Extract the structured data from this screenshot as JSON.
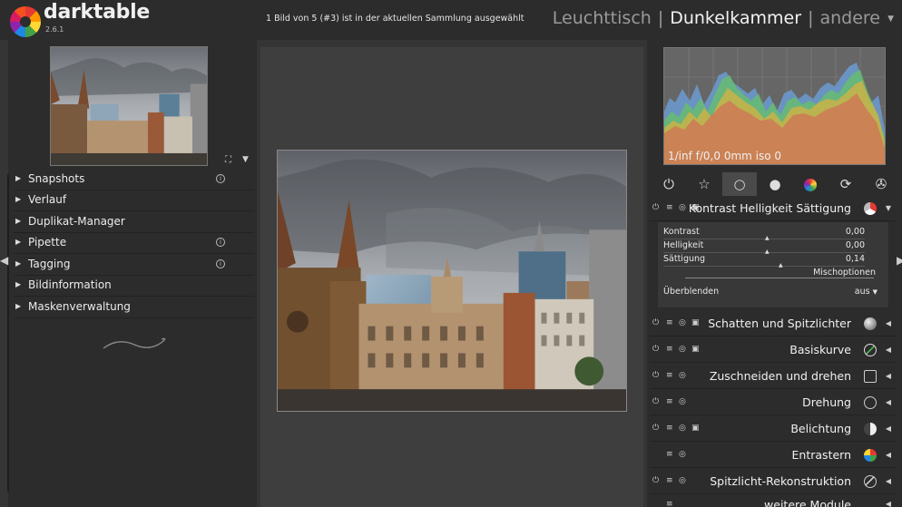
{
  "app": {
    "name": "darktable",
    "version": "2.6.1"
  },
  "status": "1 Bild von 5 (#3) ist in der aktuellen Sammlung ausgewählt",
  "views": [
    {
      "label": "Leuchttisch",
      "active": false
    },
    {
      "label": "Dunkelkammer",
      "active": true
    },
    {
      "label": "andere",
      "active": false
    }
  ],
  "view_separator": "|",
  "left_panel": {
    "items": [
      {
        "label": "Snapshots",
        "info": true
      },
      {
        "label": "Verlauf",
        "info": false
      },
      {
        "label": "Duplikat-Manager",
        "info": false
      },
      {
        "label": "Pipette",
        "info": true
      },
      {
        "label": "Tagging",
        "info": true
      },
      {
        "label": "Bildinformation",
        "info": false
      },
      {
        "label": "Maskenverwaltung",
        "info": false
      }
    ]
  },
  "exif": "1/inf f/0,0 0mm iso 0",
  "group_tabs": [
    "power-icon",
    "star-icon",
    "circle-icon",
    "sphere-icon",
    "color-wheel-icon",
    "refresh-icon",
    "aperture-icon"
  ],
  "active_module": {
    "name": "Kontrast Helligkeit Sättigung",
    "sliders": [
      {
        "label": "Kontrast",
        "value": "0,00",
        "position": 0.5
      },
      {
        "label": "Helligkeit",
        "value": "0,00",
        "position": 0.5
      },
      {
        "label": "Sättigung",
        "value": "0,14",
        "position": 0.57
      }
    ],
    "mix_options": "Mischoptionen",
    "blend_label": "Überblenden",
    "blend_value": "aus"
  },
  "modules": [
    {
      "name": "Schatten und Spitzlichter",
      "icon": "sphere-icon",
      "color": "#888888"
    },
    {
      "name": "Basiskurve",
      "icon": "curve-icon",
      "color": "#4caf50"
    },
    {
      "name": "Zuschneiden und drehen",
      "icon": "crop-icon",
      "color": "#bbbbbb"
    },
    {
      "name": "Drehung",
      "icon": "rotate-icon",
      "color": "#bbbbbb"
    },
    {
      "name": "Belichtung",
      "icon": "exposure-icon",
      "color": "#dddddd"
    },
    {
      "name": "Entrastern",
      "icon": "demosaic-icon",
      "color": "#e53935"
    },
    {
      "name": "Spitzlicht-Rekonstruktion",
      "icon": "highlight-icon",
      "color": "#bbbbbb"
    },
    {
      "name": "weitere Module",
      "icon": "",
      "color": ""
    }
  ]
}
